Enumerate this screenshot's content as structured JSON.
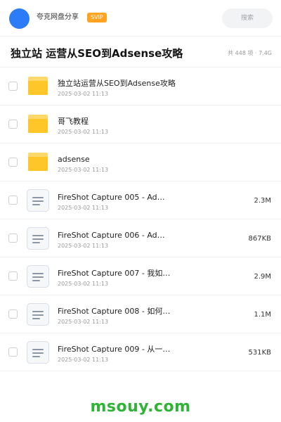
{
  "header": {
    "share_title": "夸克网盘分享",
    "badge": "SVIP",
    "search_placeholder": "搜索"
  },
  "folder": {
    "title": "独立站 运营从SEO到Adsense攻略",
    "meta": "共 448 项 · 7.4G"
  },
  "files": [
    {
      "type": "folder",
      "name": "独立站运营从SEO到Adsense攻略",
      "date": "2025-03-02 11:13",
      "size": ""
    },
    {
      "type": "folder",
      "name": "哥飞教程",
      "date": "2025-03-02 11:13",
      "size": ""
    },
    {
      "type": "folder",
      "name": "adsense",
      "date": "2025-03-02 11:13",
      "size": ""
    },
    {
      "type": "doc",
      "name": "FireShot Capture 005 - Ad…",
      "date": "2025-03-02 11:13",
      "size": "2.3M"
    },
    {
      "type": "doc",
      "name": "FireShot Capture 006 - Ad…",
      "date": "2025-03-02 11:13",
      "size": "867KB"
    },
    {
      "type": "doc",
      "name": "FireShot Capture 007 - 我如…",
      "date": "2025-03-02 11:13",
      "size": "2.9M"
    },
    {
      "type": "doc",
      "name": "FireShot Capture 008 - 如何…",
      "date": "2025-03-02 11:13",
      "size": "1.1M"
    },
    {
      "type": "doc",
      "name": "FireShot Capture 009 - 从一…",
      "date": "2025-03-02 11:13",
      "size": "531KB"
    }
  ],
  "watermark": "msouy.com",
  "colors": {
    "avatar": "#2b7cf6",
    "badge": "#ffa321",
    "folder": "#ffc629",
    "watermark": "#2fb335"
  }
}
